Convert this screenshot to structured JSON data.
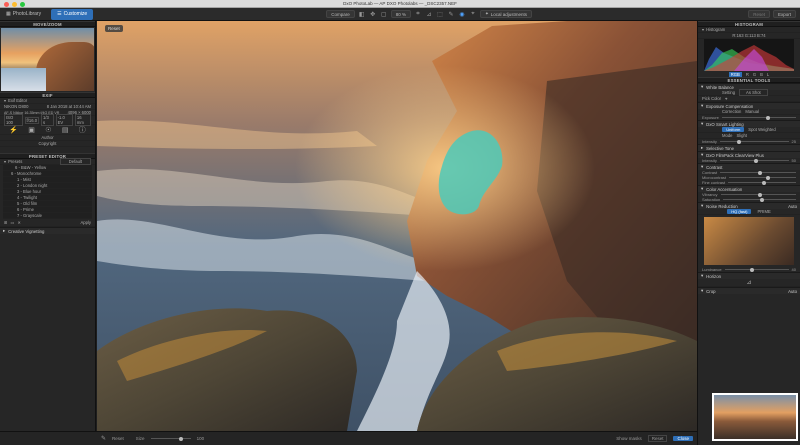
{
  "window": {
    "title": "DxO PhotoLab — AP DXO Photolabs — _DSC2357.NEF"
  },
  "toolbar": {
    "library_tab": "PhotoLibrary",
    "customize_tab": "Customize",
    "compare_label": "Compare",
    "zoom_value": "80 %",
    "local_adjust_label": "Local adjustments",
    "undo_label": "Reset",
    "export_label": "Export"
  },
  "left": {
    "move_zoom_header": "MOVE/ZOOM",
    "exif_header": "EXIF",
    "exif_editor": "Exif Editor",
    "camera": "NIKON D800",
    "date": "8 Jan 2018 at 10:44 AM",
    "lens": "AF-S Nikkor 16-35mm f/4G ED VR",
    "dims": "4096 × 6000",
    "iso": "ISO 100",
    "aperture": "f/16.0",
    "shutter": "1/3 s",
    "ev": "-1.0 EV",
    "focal": "16 mm",
    "author_label": "Author",
    "copyright_label": "Copyright",
    "preset_header": "PRESET EDITOR",
    "presets_label": "Presets",
    "presets_filter": "Default",
    "presets": [
      "6 - B&W - Yellow",
      "6 - Monochrome",
      "1 - Mist",
      "2 - London night",
      "3 - Blue hour",
      "4 - Twilight",
      "5 - Old film",
      "6 - Prime",
      "7 - Grayscale"
    ],
    "apply_label": "Apply",
    "creative_label": "Creative Vignetting"
  },
  "main": {
    "badge": "Reset"
  },
  "right": {
    "histogram_header": "HISTOGRAM",
    "histogram_label": "Histogram",
    "histogram_readout": "R:163 G:113 B:74",
    "channels": [
      "RGB",
      "R",
      "G",
      "B",
      "L"
    ],
    "essential_header": "ESSENTIAL TOOLS",
    "white_balance": "White Balance",
    "wb_setting_label": "Setting",
    "wb_setting": "As Shot",
    "pick_color": "Pick Color",
    "exposure": "Exposure Compensation",
    "exposure_mode_label": "Correction",
    "exposure_mode": "Manual",
    "exposure_sub": "Exposure",
    "smart_lighting": "DxO Smart Lighting",
    "uniform": "Uniform",
    "spot_weighted": "Spot Weighted",
    "mode_label": "Mode",
    "mode_value": "Slight",
    "intensity_label": "Intensity",
    "intensity_value": "25",
    "selective_tone": "Selective Tone",
    "clearview": "DxO FilmPack ClearView Plus",
    "clearview_value": "50",
    "contrast": "Contrast",
    "contrast_label": "Contrast",
    "microcontrast_label": "Microcontrast",
    "finecontrast_label": "Fine contrast",
    "color_accent": "Color Accentuation",
    "vibrancy_label": "Vibrancy",
    "saturation_label": "Saturation",
    "noise": "Noise Reduction",
    "noise_auto": "Auto",
    "hq_fast": "HQ (fast)",
    "prime": "PRIME",
    "luminance_label": "Luminance",
    "luminance_value": "40",
    "horizon": "Horizon",
    "crop": "Crop",
    "crop_auto": "Auto"
  },
  "bottom": {
    "reset": "Reset",
    "size": "Size",
    "zoom": "100",
    "show_masks": "Show masks",
    "reset_btn": "Reset",
    "close_btn": "Close"
  }
}
